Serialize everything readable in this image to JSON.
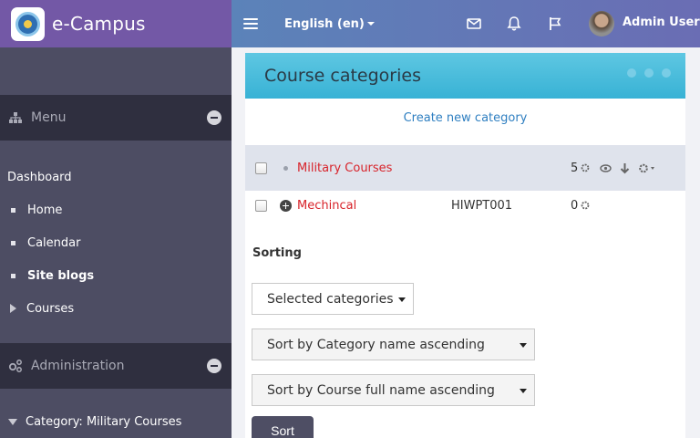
{
  "brand": {
    "title": "e-Campus"
  },
  "topnav": {
    "language": "English (en)",
    "user_name": "Admin User"
  },
  "sidebar": {
    "menu_header": "Menu",
    "items": [
      {
        "label": "Dashboard"
      },
      {
        "label": "Home"
      },
      {
        "label": "Calendar"
      },
      {
        "label": "Site blogs"
      },
      {
        "label": "Courses"
      }
    ],
    "admin_header": "Administration",
    "admin_items": [
      {
        "label": "Category: Military Courses"
      }
    ]
  },
  "main": {
    "title": "Course categories",
    "create_link": "Create new category",
    "categories": [
      {
        "name": "Military Courses",
        "idnumber": "",
        "count": "5"
      },
      {
        "name": "Mechincal",
        "idnumber": "HIWPT001",
        "count": "0"
      }
    ],
    "sorting_label": "Sorting",
    "selects": [
      {
        "value": "Selected categories"
      },
      {
        "value": "Sort by Category name ascending"
      },
      {
        "value": "Sort by Course full name ascending"
      }
    ],
    "sort_button": "Sort"
  },
  "colors": {
    "brand": "#7358a6",
    "topnav_start": "#5b83b9",
    "topnav_end": "#6a6db4",
    "sidebar": "#4d4d63",
    "sidebar_header": "#2f2f3f",
    "panel_header": "#38b2d5",
    "category_link": "#d8232a",
    "create_link": "#2f7fc1"
  },
  "icons": {
    "hamburger": "hamburger-icon",
    "mail": "mail-icon",
    "notifications": "bell-icon",
    "flag": "flag-icon",
    "menu": "sitemap-icon",
    "administration": "cogs-icon"
  }
}
